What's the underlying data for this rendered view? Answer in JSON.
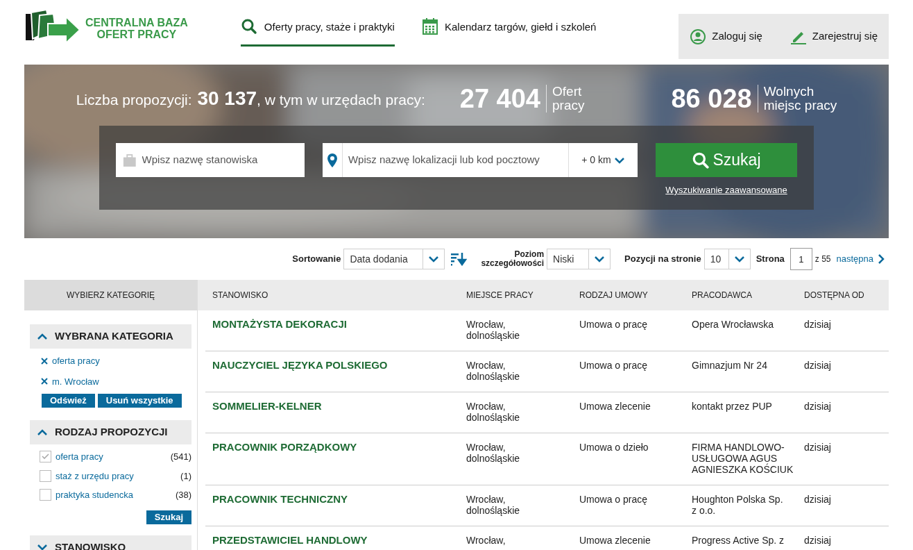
{
  "logo": {
    "line1": "CENTRALNA BAZA",
    "line2": "OFERT PRACY"
  },
  "nav": [
    {
      "label": "Oferty pracy, staże i praktyki",
      "kind": "search",
      "selected": true
    },
    {
      "label": "Kalendarz targów, giełd i szkoleń",
      "kind": "calendar",
      "selected": false
    }
  ],
  "account": [
    {
      "label": "Zaloguj się",
      "kind": "user"
    },
    {
      "label": "Zarejestruj się",
      "kind": "pencil"
    }
  ],
  "hero": {
    "count_label": "Liczba propozycji:",
    "count": "30 137",
    "count_suffix": ", w tym w urzędach pracy:",
    "stats": [
      {
        "value": "27 404",
        "label1": "Ofert",
        "label2": "pracy"
      },
      {
        "value": "86 028",
        "label1": "Wolnych",
        "label2": "miejsc pracy"
      }
    ],
    "position_placeholder": "Wpisz nazwę stanowiska",
    "location_placeholder": "Wpisz nazwę lokalizacji lub kod pocztowy",
    "radius": "+ 0 km",
    "search_button": "Szukaj",
    "advanced_link": "Wyszukiwanie zaawansowane"
  },
  "toolbar": {
    "sort_label": "Sortowanie",
    "sort_value": "Data dodania",
    "detail_label1": "Poziom",
    "detail_label2": "szczegółowości",
    "detail_value": "Niski",
    "per_page_label": "Pozycji na stronie",
    "per_page_value": "10",
    "page_label": "Strona",
    "page_value": "1",
    "page_total": "z 55",
    "next_link": "następna"
  },
  "sidebar": {
    "header": "WYBIERZ KATEGORIĘ",
    "selected_section": {
      "title": "WYBRANA KATEGORIA",
      "expanded": true,
      "items": [
        "oferta pracy",
        "m. Wrocław"
      ],
      "buttons": [
        "Odśwież",
        "Usuń wszystkie"
      ]
    },
    "type_section": {
      "title": "RODZAJ PROPOZYCJI",
      "expanded": true,
      "options": [
        {
          "label": "oferta pracy",
          "count": "(541)",
          "checked": true
        },
        {
          "label": "staż z urzędu pracy",
          "count": "(1)",
          "checked": false
        },
        {
          "label": "praktyka studencka",
          "count": "(38)",
          "checked": false
        }
      ],
      "button": "Szukaj"
    },
    "next_section": {
      "title": "STANOWISKO",
      "expanded": false
    }
  },
  "table": {
    "columns": [
      "STANOWISKO",
      "MIEJSCE PRACY",
      "RODZAJ UMOWY",
      "PRACODAWCA",
      "DOSTĘPNA OD"
    ],
    "rows": [
      {
        "title": "MONTAŻYSTA DEKORACJI",
        "place": [
          "Wrocław,",
          "dolnośląskie"
        ],
        "contract": "Umowa o pracę",
        "employer": [
          "Opera Wrocławska"
        ],
        "date": "dzisiaj"
      },
      {
        "title": "NAUCZYCIEL JĘZYKA POLSKIEGO",
        "place": [
          "Wrocław,",
          "dolnośląskie"
        ],
        "contract": "Umowa o pracę",
        "employer": [
          "Gimnazjum Nr 24"
        ],
        "date": "dzisiaj"
      },
      {
        "title": "SOMMELIER-KELNER",
        "place": [
          "Wrocław,",
          "dolnośląskie"
        ],
        "contract": "Umowa zlecenie",
        "employer": [
          "kontakt przez PUP"
        ],
        "date": "dzisiaj"
      },
      {
        "title": "PRACOWNIK PORZĄDKOWY",
        "place": [
          "Wrocław,",
          "dolnośląskie"
        ],
        "contract": "Umowa o dzieło",
        "employer": [
          "FIRMA HANDLOWO-",
          "USŁUGOWA AGUS",
          "AGNIESZKA KOŚCIUK"
        ],
        "date": "dzisiaj"
      },
      {
        "title": "PRACOWNIK TECHNICZNY",
        "place": [
          "Wrocław,",
          "dolnośląskie"
        ],
        "contract": "Umowa o pracę",
        "employer": [
          "Houghton Polska Sp.",
          "z o.o."
        ],
        "date": "dzisiaj"
      },
      {
        "title": "PRZEDSTAWICIEL HANDLOWY",
        "place": [
          "Wrocław,"
        ],
        "contract": "Umowa zlecenie",
        "employer": [
          "Progress Active Sp. z"
        ],
        "date": "dzisiaj"
      }
    ]
  }
}
